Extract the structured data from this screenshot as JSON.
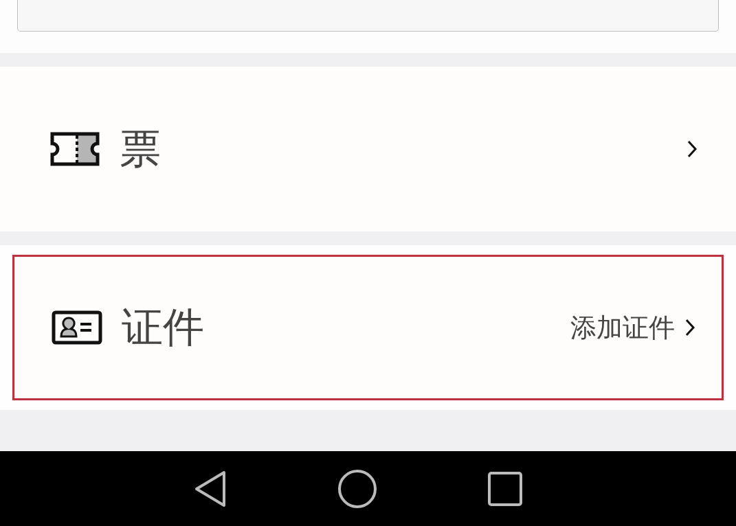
{
  "rows": [
    {
      "kind": "ticket",
      "label": "票",
      "highlighted": false
    },
    {
      "kind": "id_card",
      "label": "证件",
      "value": "添加证件",
      "highlighted": true
    }
  ]
}
